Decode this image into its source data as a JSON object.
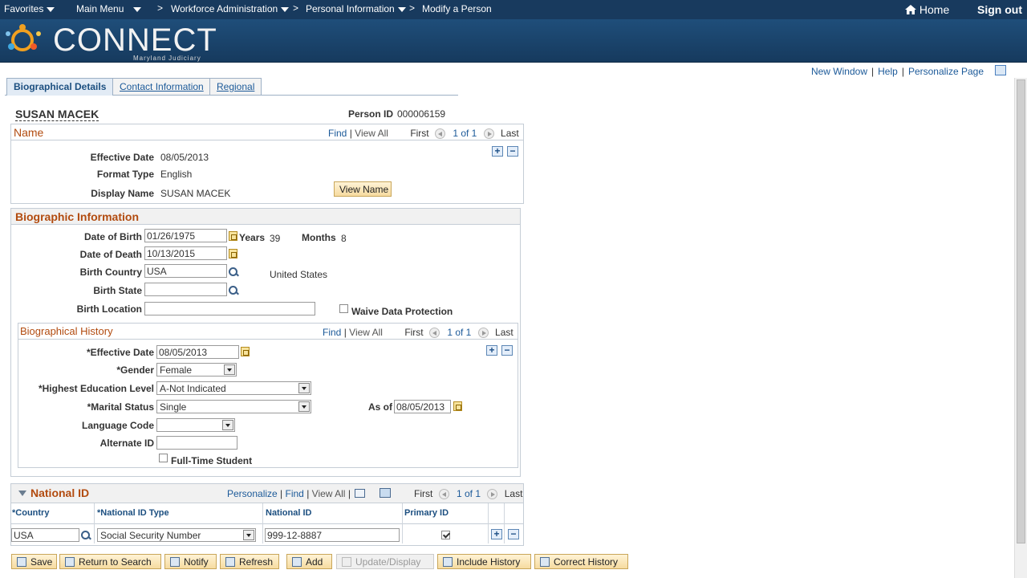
{
  "topnav": {
    "favorites": "Favorites",
    "main_menu": "Main Menu",
    "crumbs": [
      "Workforce Administration",
      "Personal Information",
      "Modify a Person"
    ],
    "home": "Home",
    "signout": "Sign out"
  },
  "banner": {
    "logo": "CONNECT",
    "sub": "Maryland Judiciary"
  },
  "pagelinks": {
    "new_window": "New Window",
    "help": "Help",
    "personalize": "Personalize Page"
  },
  "tabs": [
    "Biographical Details",
    "Contact Information",
    "Regional"
  ],
  "person": {
    "name": "SUSAN MACEK",
    "id_label": "Person ID",
    "id": "000006159"
  },
  "name_section": {
    "title": "Name",
    "find": "Find",
    "viewall": "View All",
    "first": "First",
    "count": "1 of 1",
    "last": "Last",
    "effective_date_label": "Effective Date",
    "effective_date": "08/05/2013",
    "format_type_label": "Format Type",
    "format_type": "English",
    "display_name_label": "Display Name",
    "display_name": "SUSAN MACEK",
    "view_name": "View Name"
  },
  "bio": {
    "title": "Biographic Information",
    "dob_label": "Date of Birth",
    "dob": "01/26/1975",
    "years_label": "Years",
    "years": "39",
    "months_label": "Months",
    "months": "8",
    "dod_label": "Date of Death",
    "dod": "10/13/2015",
    "birth_country_label": "Birth Country",
    "birth_country": "USA",
    "birth_country_desc": "United States",
    "birth_state_label": "Birth State",
    "birth_state": "",
    "birth_location_label": "Birth Location",
    "birth_location": "",
    "waive_label": "Waive Data Protection"
  },
  "history": {
    "title": "Biographical History",
    "find": "Find",
    "viewall": "View All",
    "first": "First",
    "count": "1 of 1",
    "last": "Last",
    "eff_label": "*Effective Date",
    "eff": "08/05/2013",
    "gender_label": "*Gender",
    "gender": "Female",
    "edu_label": "*Highest Education Level",
    "edu": "A-Not Indicated",
    "marital_label": "*Marital Status",
    "marital": "Single",
    "asof_label": "As of",
    "asof": "08/05/2013",
    "lang_label": "Language Code",
    "lang": "",
    "altid_label": "Alternate ID",
    "altid": "",
    "fulltime_label": "Full-Time Student"
  },
  "national": {
    "title": "National ID",
    "personalize": "Personalize",
    "find": "Find",
    "viewall": "View All",
    "first": "First",
    "count": "1 of 1",
    "last": "Last",
    "col_country": "*Country",
    "col_type": "*National ID Type",
    "col_id": "National ID",
    "col_primary": "Primary ID",
    "country": "USA",
    "type": "Social Security Number",
    "id": "999-12-8887"
  },
  "buttons": {
    "save": "Save",
    "return": "Return to Search",
    "notify": "Notify",
    "refresh": "Refresh",
    "add": "Add",
    "update": "Update/Display",
    "include": "Include History",
    "correct": "Correct History"
  }
}
